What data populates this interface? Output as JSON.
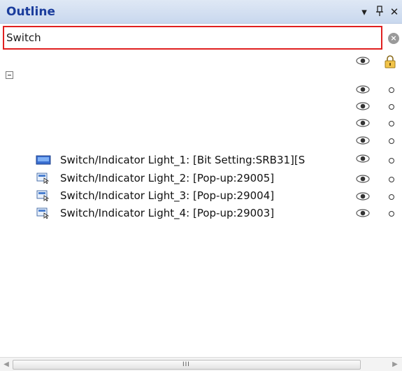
{
  "panel": {
    "title": "Outline",
    "menu_icon": "dropdown-arrow-icon",
    "pin_icon": "pin-icon",
    "close_icon": "close-icon"
  },
  "search": {
    "value": "Switch",
    "clear_icon": "clear-search-icon"
  },
  "tree": {
    "root_expander": "collapse-icon",
    "items": [
      {
        "label": "Switch/Indicator Light_1: [Bit Setting:SRB31][S",
        "icon": "bit-switch-icon"
      },
      {
        "label": "Switch/Indicator Light_2: [Pop-up:29005]",
        "icon": "popup-switch-icon"
      },
      {
        "label": "Switch/Indicator Light_3: [Pop-up:29004]",
        "icon": "popup-switch-icon"
      },
      {
        "label": "Switch/Indicator Light_4: [Pop-up:29003]",
        "icon": "popup-switch-icon"
      }
    ]
  },
  "scrollbar": {
    "grip": "III"
  },
  "colors": {
    "title": "#1a3c9c",
    "search_border": "#e02020",
    "selection": "#cfe3fa"
  }
}
